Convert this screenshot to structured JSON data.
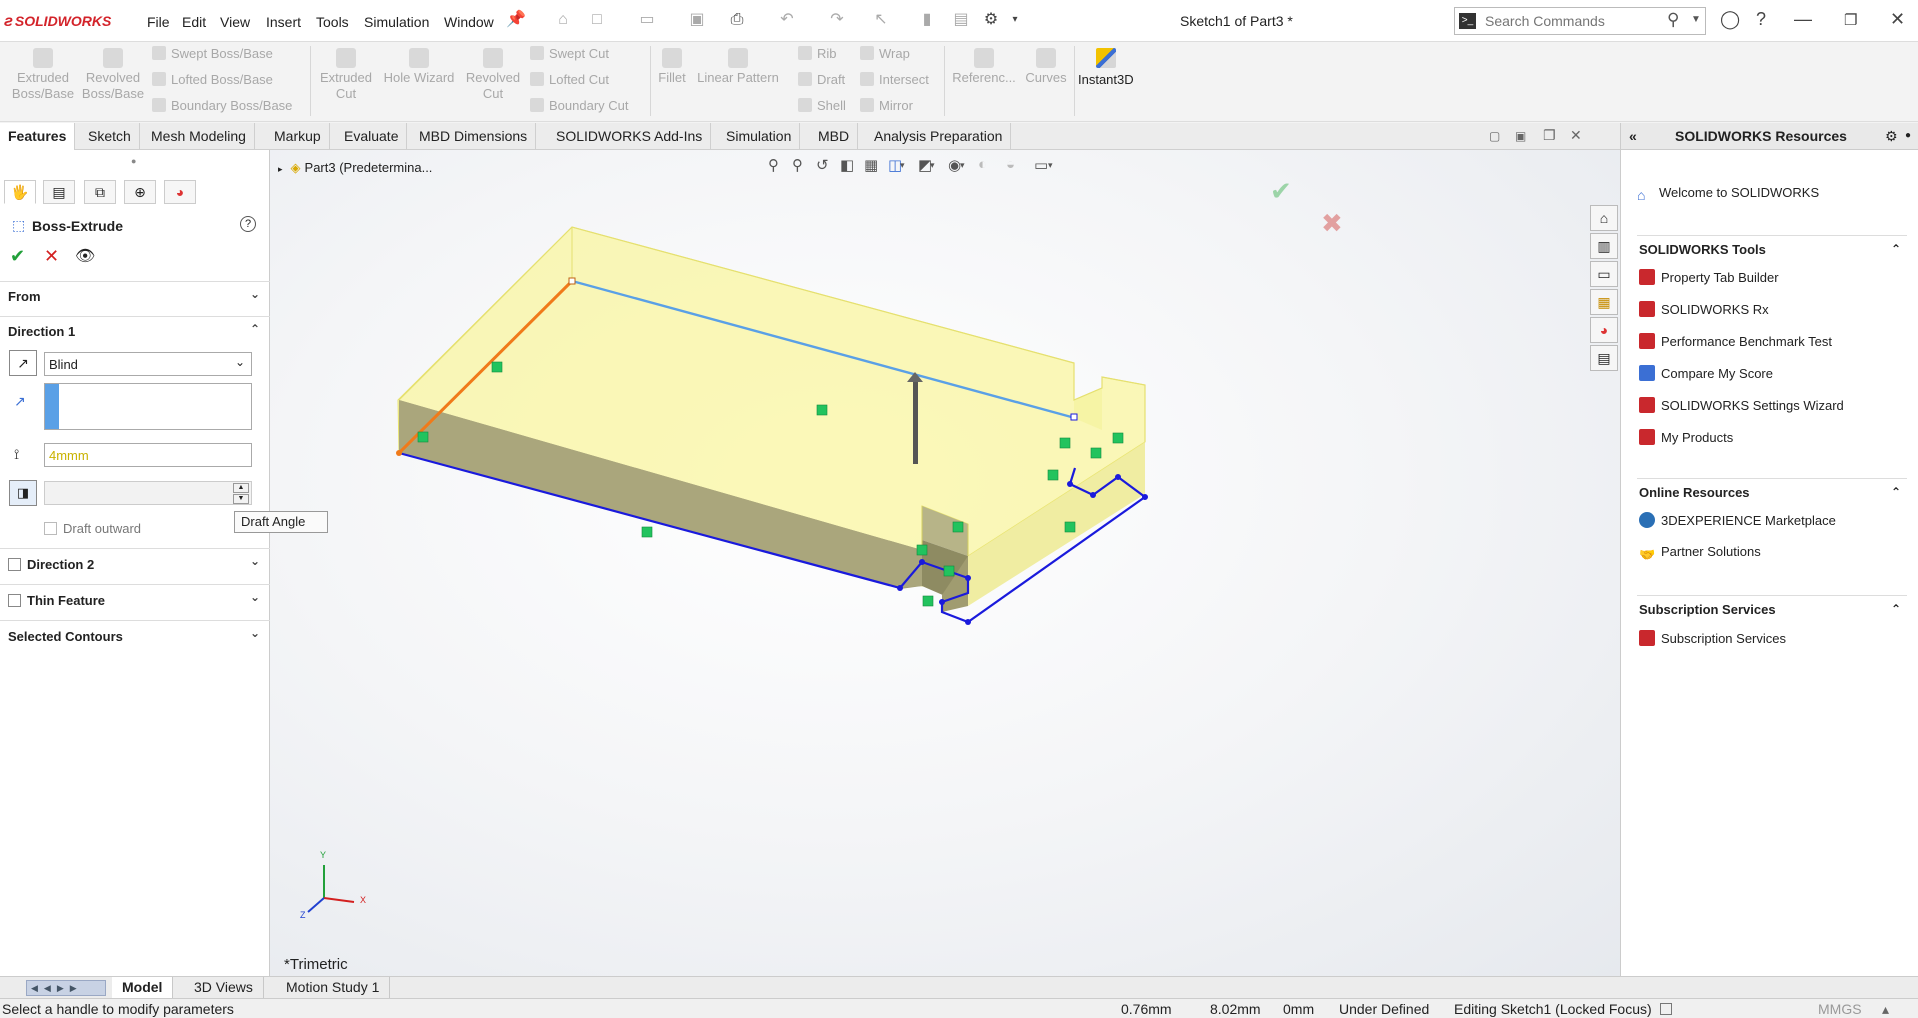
{
  "app": {
    "logo_text": "SOLIDWORKS",
    "doc_title": "Sketch1 of Part3 *",
    "menu": [
      "File",
      "Edit",
      "View",
      "Insert",
      "Tools",
      "Simulation",
      "Window"
    ],
    "search_placeholder": "Search Commands"
  },
  "commands": {
    "extruded_boss": "Extruded Boss/Base",
    "revolved_boss": "Revolved Boss/Base",
    "swept_boss": "Swept Boss/Base",
    "lofted_boss": "Lofted Boss/Base",
    "boundary_boss": "Boundary Boss/Base",
    "extruded_cut": "Extruded Cut",
    "hole_wizard": "Hole Wizard",
    "revolved_cut": "Revolved Cut",
    "swept_cut": "Swept Cut",
    "lofted_cut": "Lofted Cut",
    "boundary_cut": "Boundary Cut",
    "fillet": "Fillet",
    "linear_pattern": "Linear Pattern",
    "rib": "Rib",
    "draft": "Draft",
    "shell": "Shell",
    "wrap": "Wrap",
    "intersect": "Intersect",
    "mirror": "Mirror",
    "reference": "Referenc...",
    "curves": "Curves",
    "instant3d": "Instant3D"
  },
  "tabs": [
    "Features",
    "Sketch",
    "Mesh Modeling",
    "Markup",
    "Evaluate",
    "MBD Dimensions",
    "SOLIDWORKS Add-Ins",
    "Simulation",
    "MBD",
    "Analysis Preparation"
  ],
  "property_manager": {
    "title": "Boss-Extrude",
    "from_label": "From",
    "direction1_label": "Direction 1",
    "end_condition": "Blind",
    "depth_value": "4mmm",
    "draft_outward_label": "Draft outward",
    "draft_tooltip": "Draft Angle",
    "direction2_label": "Direction 2",
    "thin_feature_label": "Thin Feature",
    "selected_contours_label": "Selected Contours"
  },
  "viewport": {
    "tree_root": "Part3  (Predetermina...",
    "view_name": "*Trimetric",
    "triad": {
      "x": "X",
      "y": "Y",
      "z": "Z"
    }
  },
  "task_pane": {
    "title": "SOLIDWORKS Resources",
    "welcome": "Welcome to SOLIDWORKS",
    "groups": [
      {
        "title": "SOLIDWORKS Tools",
        "links": [
          "Property Tab Builder",
          "SOLIDWORKS Rx",
          "Performance Benchmark Test",
          "Compare My Score",
          "SOLIDWORKS Settings Wizard",
          "My Products"
        ]
      },
      {
        "title": "Online Resources",
        "links": [
          "3DEXPERIENCE Marketplace",
          "Partner Solutions"
        ]
      },
      {
        "title": "Subscription Services",
        "links": [
          "Subscription Services"
        ]
      }
    ]
  },
  "bottom_tabs": [
    "Model",
    "3D Views",
    "Motion Study 1"
  ],
  "status": {
    "message": "Select a handle to modify parameters",
    "x": "0.76mm",
    "y": "8.02mm",
    "z": "0mm",
    "sketch_state": "Under Defined",
    "editing": "Editing Sketch1 (Locked Focus)",
    "units": "MMGS"
  },
  "colors": {
    "brand_red": "#d3232a",
    "preview_yellow": "#f7f49a",
    "sketch_blue": "#1a1adc",
    "selected_orange": "#f07a1a",
    "highlight_blue": "#5aa0e6",
    "relation_green": "#22c35e"
  }
}
